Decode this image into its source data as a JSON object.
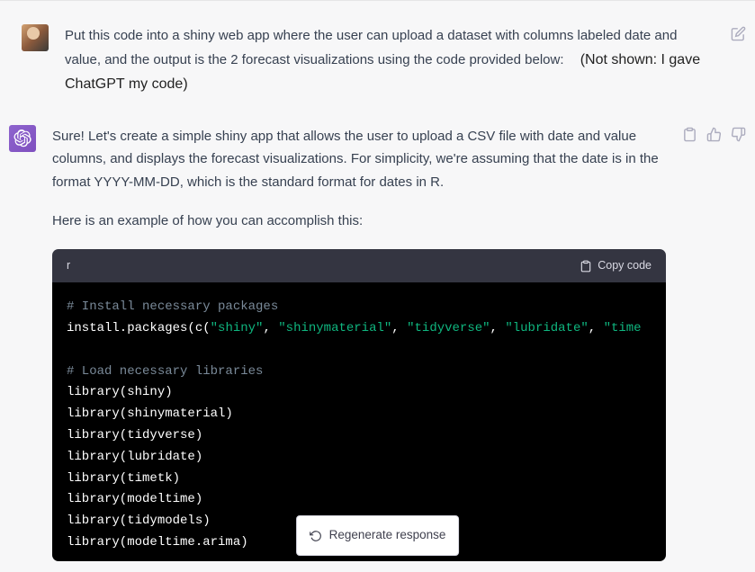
{
  "user_message": {
    "text_line1": "Put this code into a shiny web app where the user can upload a dataset with columns labeled date and value, and the output is the 2 forecast visualizations using the code provided below:",
    "annotation": "(Not shown: I gave ChatGPT my code)"
  },
  "assistant_message": {
    "paragraph1": "Sure! Let's create a simple shiny app that allows the user to upload a CSV file with date and value columns, and displays the forecast visualizations. For simplicity, we're assuming that the date is in the format YYYY-MM-DD, which is the standard format for dates in R.",
    "paragraph2": "Here is an example of how you can accomplish this:"
  },
  "code": {
    "language": "r",
    "copy_label": "Copy code",
    "lines": {
      "c1": "# Install necessary packages",
      "l2a": "install.packages(",
      "l2b": "c",
      "l2c": "(",
      "l2s1": "\"shiny\"",
      "l2s2": "\"shinymaterial\"",
      "l2s3": "\"tidyverse\"",
      "l2s4": "\"lubridate\"",
      "l2s5": "\"time",
      "c2": "# Load necessary libraries",
      "l4": "library(shiny)",
      "l5": "library(shinymaterial)",
      "l6": "library(tidyverse)",
      "l7": "library(lubridate)",
      "l8": "library(timetk)",
      "l9": "library(modeltime)",
      "l10": "library(tidymodels)",
      "l11": "library(modeltime.arima)"
    }
  },
  "regenerate_label": "Regenerate response",
  "icons": {
    "edit": "edit-icon",
    "clipboard": "clipboard-icon",
    "thumbs_up": "thumbs-up-icon",
    "thumbs_down": "thumbs-down-icon",
    "refresh": "refresh-icon"
  }
}
